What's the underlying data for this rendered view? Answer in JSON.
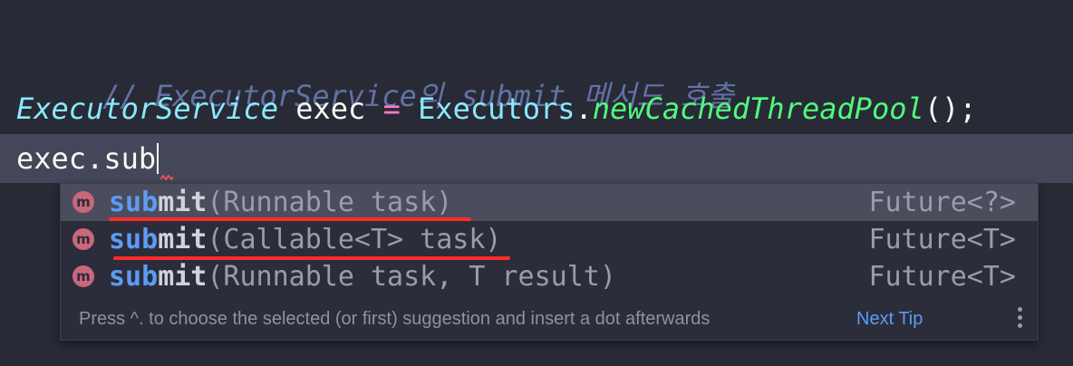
{
  "editor": {
    "comment": "// ExecutorService의 submit 메서드 호출",
    "line1": {
      "type": "ExecutorService",
      "var": " exec ",
      "op": "=",
      "cls": " Executors",
      "dot": ".",
      "method": "newCachedThreadPool",
      "tail": "();"
    },
    "line2": "exec.sub"
  },
  "completion": {
    "items": [
      {
        "match": "sub",
        "rest": "mit",
        "params": "(Runnable task)",
        "return_type": "Future<?>",
        "icon": "m-method-icon",
        "selected": true
      },
      {
        "match": "sub",
        "rest": "mit",
        "params": "(Callable<T> task)",
        "return_type": "Future<T>",
        "icon": "m-method-icon",
        "selected": false
      },
      {
        "match": "sub",
        "rest": "mit",
        "params": "(Runnable task, T result)",
        "return_type": "Future<T>",
        "icon": "m-method-icon",
        "selected": false
      }
    ],
    "icon_letter": "m",
    "footer_text": "Press ^. to choose the selected (or first) suggestion and insert a dot afterwards",
    "next_tip": "Next Tip"
  },
  "colors": {
    "background": "#282a36",
    "annotation_underline": "#ff2b2b",
    "match_highlight": "#5c9cf5"
  }
}
